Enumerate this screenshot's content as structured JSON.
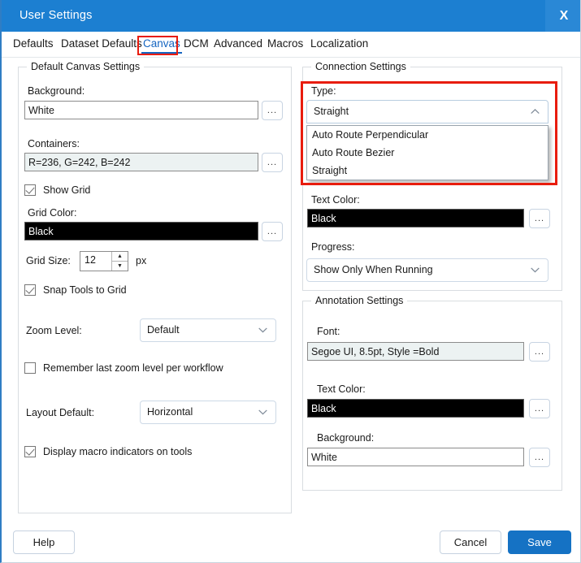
{
  "window": {
    "title": "User Settings",
    "close_icon": "close-icon",
    "close_label": "X"
  },
  "tabs": [
    {
      "label": "Defaults",
      "active": false
    },
    {
      "label": "Dataset Defaults",
      "active": false
    },
    {
      "label": "Canvas",
      "active": true
    },
    {
      "label": "DCM",
      "active": false
    },
    {
      "label": "Advanced",
      "active": false
    },
    {
      "label": "Macros",
      "active": false
    },
    {
      "label": "Localization",
      "active": false
    }
  ],
  "canvas_group": {
    "title": "Default Canvas Settings",
    "background_label": "Background:",
    "background_value": "White",
    "containers_label": "Containers:",
    "containers_value": "R=236, G=242, B=242",
    "show_grid_label": "Show Grid",
    "show_grid_checked": true,
    "grid_color_label": "Grid Color:",
    "grid_color_value": "Black",
    "grid_size_label": "Grid Size:",
    "grid_size_value": "12",
    "grid_size_unit": "px",
    "snap_tools_label": "Snap Tools to Grid",
    "snap_tools_checked": true,
    "zoom_level_label": "Zoom Level:",
    "zoom_level_value": "Default",
    "remember_zoom_label": "Remember last zoom level per workflow",
    "remember_zoom_checked": false,
    "layout_default_label": "Layout Default:",
    "layout_default_value": "Horizontal",
    "display_macro_label": "Display macro indicators on tools",
    "display_macro_checked": true,
    "ellipsis_label": "..."
  },
  "connection_group": {
    "title": "Connection Settings",
    "type_label": "Type:",
    "type_value": "Straight",
    "type_options": [
      "Auto Route Perpendicular",
      "Auto Route Bezier",
      "Straight"
    ],
    "type_selected_option": "Straight",
    "text_color_label": "Text Color:",
    "text_color_value": "Black",
    "progress_label": "Progress:",
    "progress_value": "Show Only When Running",
    "ellipsis_label": "..."
  },
  "annotation_group": {
    "title": "Annotation Settings",
    "font_label": "Font:",
    "font_value": "Segoe UI, 8.5pt, Style =Bold",
    "text_color_label": "Text Color:",
    "text_color_value": "Black",
    "background_label": "Background:",
    "background_value": "White",
    "ellipsis_label": "..."
  },
  "footer": {
    "help_label": "Help",
    "cancel_label": "Cancel",
    "save_label": "Save"
  },
  "colors": {
    "titlebar": "#1c7fd1",
    "accent": "#1565c0",
    "highlight_red": "#e81c0d",
    "primary_button": "#1572c4",
    "tinted_field": "#ecf2f2"
  }
}
